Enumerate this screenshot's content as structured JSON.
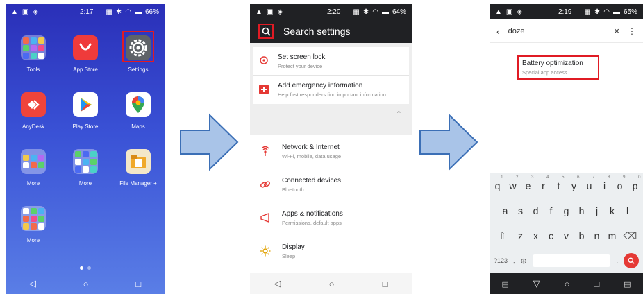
{
  "phone1": {
    "status": {
      "time": "2:17",
      "battery": "66%"
    },
    "apps": [
      {
        "label": "Tools"
      },
      {
        "label": "App Store"
      },
      {
        "label": "Settings"
      },
      {
        "label": "AnyDesk"
      },
      {
        "label": "Play Store"
      },
      {
        "label": "Maps"
      },
      {
        "label": "More"
      },
      {
        "label": "More"
      },
      {
        "label": "File Manager +"
      },
      {
        "label": "More"
      }
    ],
    "nav": {
      "back": "◁",
      "home": "○",
      "recent": "□"
    }
  },
  "phone2": {
    "status": {
      "time": "2:20",
      "battery": "64%"
    },
    "header": {
      "title": "Search settings"
    },
    "suggestions": [
      {
        "title": "Set screen lock",
        "subtitle": "Protect your device"
      },
      {
        "title": "Add emergency information",
        "subtitle": "Help first responders find important information"
      }
    ],
    "settings": [
      {
        "title": "Network & Internet",
        "subtitle": "Wi-Fi, mobile, data usage"
      },
      {
        "title": "Connected devices",
        "subtitle": "Bluetooth"
      },
      {
        "title": "Apps & notifications",
        "subtitle": "Permissions, default apps"
      },
      {
        "title": "Display",
        "subtitle": "Sleep"
      }
    ],
    "nav": {
      "back": "◁",
      "home": "○",
      "recent": "□"
    }
  },
  "phone3": {
    "status": {
      "time": "2:19",
      "battery": "65%"
    },
    "search": {
      "query": "doze"
    },
    "result": {
      "title": "Battery optimization",
      "subtitle": "Special app access"
    },
    "keyboard": {
      "row1": [
        "q",
        "w",
        "e",
        "r",
        "t",
        "y",
        "u",
        "i",
        "o",
        "p"
      ],
      "row1_hints": [
        "1",
        "2",
        "3",
        "4",
        "5",
        "6",
        "7",
        "8",
        "9",
        "0"
      ],
      "row2": [
        "a",
        "s",
        "d",
        "f",
        "g",
        "h",
        "j",
        "k",
        "l"
      ],
      "row3": [
        "z",
        "x",
        "c",
        "v",
        "b",
        "n",
        "m"
      ],
      "sym_key": "?123",
      "comma": ",",
      "period": "."
    }
  },
  "colors": {
    "highlight": "#e01b24",
    "arrow_fill": "#a9c4e8",
    "arrow_stroke": "#3b6fb6"
  }
}
